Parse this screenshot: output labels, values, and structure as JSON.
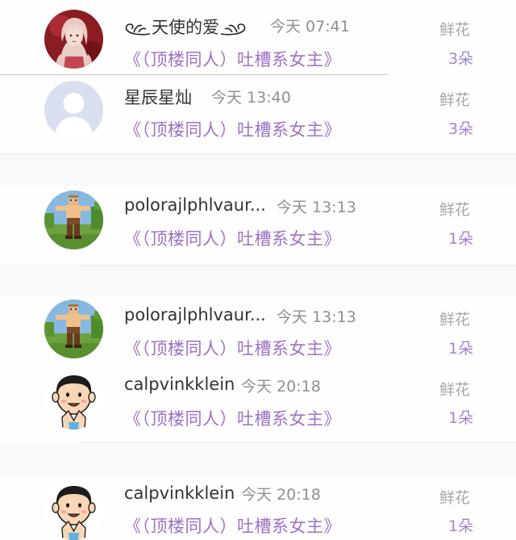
{
  "entries": [
    {
      "name": "天使的爱",
      "time": "今天 07:41",
      "novel": "《（顶楼同人）吐槽系女主》",
      "gift_label": "鲜花",
      "gift_count": "3朵",
      "avatar_icon": "anime-girl-avatar"
    },
    {
      "name": "星辰星灿",
      "time": "今天 13:40",
      "novel": "《（顶楼同人）吐槽系女主》",
      "gift_label": "鲜花",
      "gift_count": "3朵",
      "avatar_icon": "default-user-avatar"
    },
    {
      "name": "polorajlphlvaur...",
      "time": "今天 13:13",
      "novel": "《（顶楼同人）吐槽系女主》",
      "gift_label": "鲜花",
      "gift_count": "1朵",
      "avatar_icon": "pixel-character-avatar"
    },
    {
      "name": "polorajlphlvaur...",
      "time": "今天 13:13",
      "novel": "《（顶楼同人）吐槽系女主》",
      "gift_label": "鲜花",
      "gift_count": "1朵",
      "avatar_icon": "pixel-character-avatar"
    },
    {
      "name": "calpvinkklein",
      "time": "今天 20:18",
      "novel": "《（顶楼同人）吐槽系女主》",
      "gift_label": "鲜花",
      "gift_count": "1朵",
      "avatar_icon": "cartoon-boy-avatar"
    },
    {
      "name": "calpvinkklein",
      "time": "今天 20:18",
      "novel": "《（顶楼同人）吐槽系女主》",
      "gift_label": "鲜花",
      "gift_count": "1朵",
      "avatar_icon": "cartoon-boy-avatar"
    }
  ],
  "colors": {
    "novel_purple": "#9a72c4",
    "count_purple": "#a384cf",
    "muted_gray": "#a8a8a8"
  }
}
